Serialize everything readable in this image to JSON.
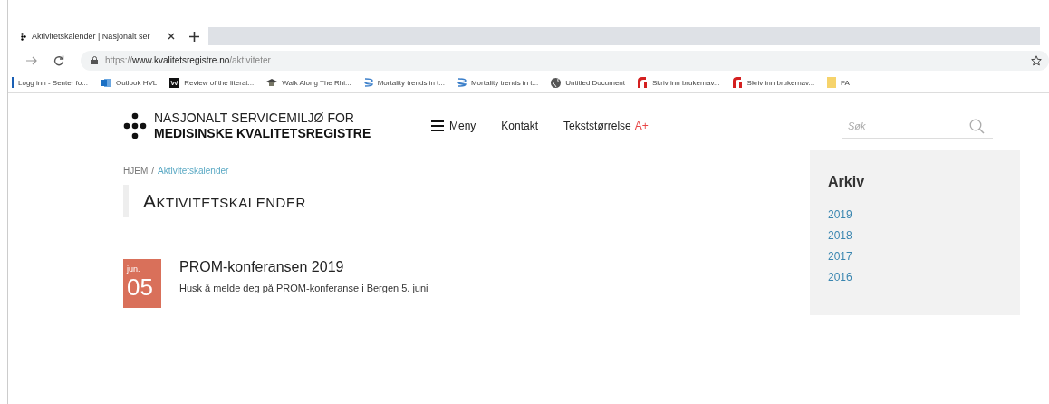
{
  "browser": {
    "tab": {
      "title": "Aktivitetskalender | Nasjonalt ser",
      "selected": true
    },
    "url": {
      "scheme": "https://",
      "host": "www.kvalitetsregistre.no",
      "path": "/aktiviteter"
    },
    "bookmarks": [
      {
        "label": "Logg inn - Senter fo...",
        "kind": "bar"
      },
      {
        "label": "Outlook HVL",
        "kind": "outlook"
      },
      {
        "label": "Review of the literat...",
        "kind": "w"
      },
      {
        "label": "Walk Along The Rhi...",
        "kind": "hat"
      },
      {
        "label": "Mortality trends in t...",
        "kind": "helix"
      },
      {
        "label": "Mortality trends in t...",
        "kind": "helix"
      },
      {
        "label": "Untitled Document",
        "kind": "globe"
      },
      {
        "label": "Skriv inn brukernav...",
        "kind": "red"
      },
      {
        "label": "Skriv inn brukernav...",
        "kind": "red"
      },
      {
        "label": "FA",
        "kind": "folder"
      }
    ]
  },
  "site": {
    "logo": {
      "line_1": "NASJONALT SERVICEMILJØ FOR",
      "line_2": "MEDISINSKE KVALITETSREGISTRE"
    },
    "nav": {
      "menu": "Meny",
      "contact": "Kontakt",
      "text_size": "Tekststørrelse",
      "text_size_button": "A+"
    },
    "search": {
      "placeholder": "Søk"
    },
    "breadcrumb": [
      {
        "label": "HJEM",
        "selected": false
      },
      {
        "label": "Aktivitetskalender",
        "selected": true
      }
    ],
    "breadcrumb_separator": "/",
    "heading": "AKTIVITETSKALENDER",
    "events": [
      {
        "month": "jun.",
        "day": "05",
        "title": "PROM-konferansen 2019",
        "description": "Husk å melde deg på PROM-konferanse i Bergen 5. juni"
      }
    ],
    "archive": {
      "title": "Arkiv",
      "years": [
        "2019",
        "2018",
        "2017",
        "2016"
      ]
    }
  }
}
